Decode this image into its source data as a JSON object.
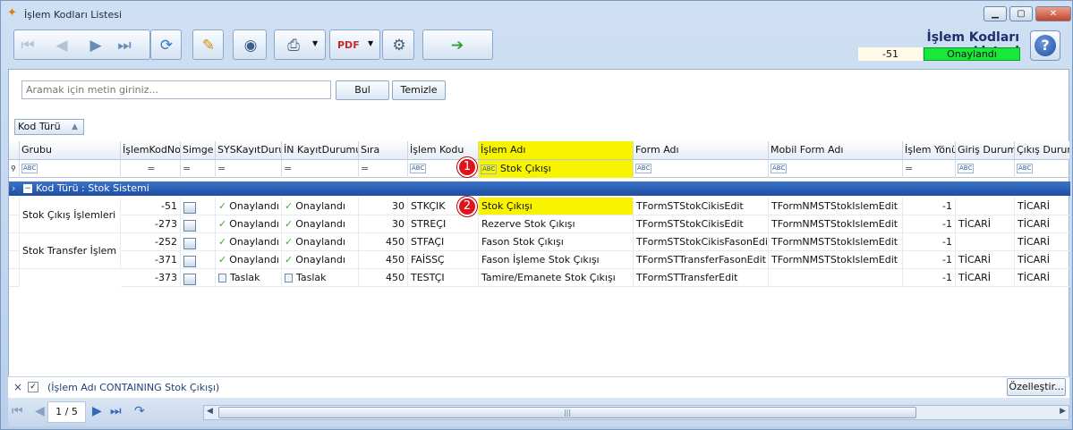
{
  "window": {
    "title": "İşlem Kodları Listesi"
  },
  "toolbar": {
    "icons": [
      "first-icon",
      "prev-icon",
      "next-icon",
      "last-icon",
      "refresh-icon",
      "edit-icon",
      "preview-icon",
      "print-icon",
      "pdf-icon",
      "tools-icon",
      "exit-icon"
    ]
  },
  "header": {
    "title": "İşlem Kodları Listesi",
    "number": "-51",
    "status": "Onaylandı",
    "status_color": "#17e83a"
  },
  "search": {
    "placeholder": "Aramak için metin giriniz...",
    "find_label": "Bul",
    "clear_label": "Temizle"
  },
  "groupbox": {
    "label": "Kod Türü"
  },
  "columns": [
    "Grubu",
    "İşlemKodNo",
    "Simge",
    "SYSKayıtDurum",
    "İN KayıtDurumu",
    "Sıra",
    "İşlem Kodu",
    "İşlem Adı",
    "Form Adı",
    "Mobil Form Adı",
    "İşlem Yönü",
    "Giriş Durum",
    "Çıkış Durum"
  ],
  "filter": {
    "islem_adi": "Stok Çıkışı"
  },
  "group_row": "Kod Türü : Stok Sistemi",
  "badges": {
    "one": "1",
    "two": "2"
  },
  "groups": [
    {
      "label": "Stok Çıkış İşlemleri"
    },
    {
      "label": "Stok Transfer İşlem"
    }
  ],
  "rows": [
    {
      "no": "-51",
      "sys": "Onaylandı",
      "in": "Onaylandı",
      "sira": "30",
      "kod": "STKÇIK",
      "ad": "Stok Çıkışı",
      "form": "TFormSTStokCikisEdit",
      "mobil": "TFormNMSTStokIslemEdit",
      "yon": "-1",
      "giris": "",
      "cikis": "TİCARİ"
    },
    {
      "no": "-273",
      "sys": "Onaylandı",
      "in": "Onaylandı",
      "sira": "30",
      "kod": "STREÇI",
      "ad": "Rezerve Stok Çıkışı",
      "form": "TFormSTStokCikisEdit",
      "mobil": "TFormNMSTStokIslemEdit",
      "yon": "-1",
      "giris": "TİCARİ",
      "cikis": "TİCARİ"
    },
    {
      "no": "-252",
      "sys": "Onaylandı",
      "in": "Onaylandı",
      "sira": "450",
      "kod": "STFAÇI",
      "ad": "Fason Stok Çıkışı",
      "form": "TFormSTStokCikisFasonEdit",
      "mobil": "TFormNMSTStokIslemEdit",
      "yon": "-1",
      "giris": "",
      "cikis": "TİCARİ"
    },
    {
      "no": "-371",
      "sys": "Onaylandı",
      "in": "Onaylandı",
      "sira": "450",
      "kod": "FAİSSÇ",
      "ad": "Fason İşleme Stok Çıkışı",
      "form": "TFormSTTransferFasonEdit",
      "mobil": "TFormNMSTStokIslemEdit",
      "yon": "-1",
      "giris": "TİCARİ",
      "cikis": "TİCARİ"
    },
    {
      "no": "-373",
      "sys": "Taslak",
      "in": "Taslak",
      "sira": "450",
      "kod": "TESTÇI",
      "ad": "Tamire/Emanete Stok Çıkışı",
      "form": "TFormSTTransferEdit",
      "mobil": "",
      "yon": "-1",
      "giris": "TİCARİ",
      "cikis": "TİCARİ"
    }
  ],
  "filter_footer": {
    "close": "×",
    "text": "(İşlem Adı CONTAINING Stok Çıkışı)",
    "customize_label": "Özelleştir..."
  },
  "pager": {
    "text": "1 / 5"
  }
}
